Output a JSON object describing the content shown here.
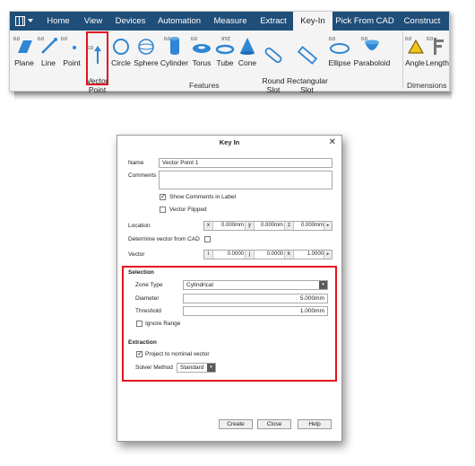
{
  "ribbon": {
    "tabs": [
      {
        "label": "Home"
      },
      {
        "label": "View"
      },
      {
        "label": "Devices"
      },
      {
        "label": "Automation"
      },
      {
        "label": "Measure"
      },
      {
        "label": "Extract"
      },
      {
        "label": "Key-In"
      },
      {
        "label": "Pick From CAD"
      },
      {
        "label": "Construct"
      }
    ],
    "active_tab": "Key-In",
    "tools": [
      {
        "label": "Plane",
        "icon": "plane-icon"
      },
      {
        "label": "Line",
        "icon": "line-icon"
      },
      {
        "label": "Point",
        "icon": "point-icon"
      },
      {
        "label": "Vector\nPoint",
        "icon": "vector-point-icon"
      },
      {
        "label": "Circle",
        "icon": "circle-icon"
      },
      {
        "label": "Sphere",
        "icon": "sphere-icon"
      },
      {
        "label": "Cylinder",
        "icon": "cylinder-icon"
      },
      {
        "label": "Torus",
        "icon": "torus-icon"
      },
      {
        "label": "Tube",
        "icon": "tube-icon"
      },
      {
        "label": "Cone",
        "icon": "cone-icon"
      },
      {
        "label": "Round\nSlot",
        "icon": "round-slot-icon"
      },
      {
        "label": "Rectangular\nSlot",
        "icon": "rectangular-slot-icon"
      },
      {
        "label": "Ellipse",
        "icon": "ellipse-icon"
      },
      {
        "label": "Paraboloid",
        "icon": "paraboloid-icon"
      },
      {
        "label": "Angle",
        "icon": "angle-icon"
      },
      {
        "label": "Length",
        "icon": "length-icon"
      }
    ],
    "groups": {
      "features": "Features",
      "dimensions": "Dimensions"
    },
    "icon_badge": "0.0",
    "tube_badge": "XYZ",
    "accent_color": "#1f4e79",
    "highlight_color": "#e0141e"
  },
  "dialog": {
    "title": "Key In",
    "name_label": "Name",
    "name_value": "Vector Point 1",
    "comments_label": "Comments",
    "comments_value": "",
    "show_comments_label": "Show Comments in Label",
    "show_comments_checked": true,
    "vector_flipped_label": "Vector Flipped",
    "vector_flipped_checked": false,
    "location_label": "Location",
    "location": {
      "x_label": "x",
      "x": "0.000mm",
      "y_label": "y",
      "y": "0.000mm",
      "z_label": "z",
      "z": "0.000mm"
    },
    "determine_label": "Determine vector from CAD",
    "determine_checked": false,
    "vector_label": "Vector",
    "vector": {
      "i_label": "i",
      "i": "0.0000",
      "j_label": "j",
      "j": "0.0000",
      "k_label": "k",
      "k": "1.0000"
    },
    "selection": {
      "heading": "Selection",
      "zone_type_label": "Zone Type",
      "zone_type_value": "Cylindrical",
      "diameter_label": "Diameter",
      "diameter_value": "5.000mm",
      "threshold_label": "Threshold",
      "threshold_value": "1.000mm",
      "ignore_range_label": "Ignore Range",
      "ignore_range_checked": false
    },
    "extraction": {
      "heading": "Extraction",
      "project_label": "Project to nominal vector",
      "project_checked": true,
      "solver_label": "Solver Method",
      "solver_value": "Standard"
    },
    "buttons": {
      "create": "Create",
      "close": "Close",
      "help": "Help"
    },
    "spin_glyph": "▸",
    "dropdown_glyph": "▾",
    "check_glyph": "✓",
    "close_glyph": "✕"
  }
}
